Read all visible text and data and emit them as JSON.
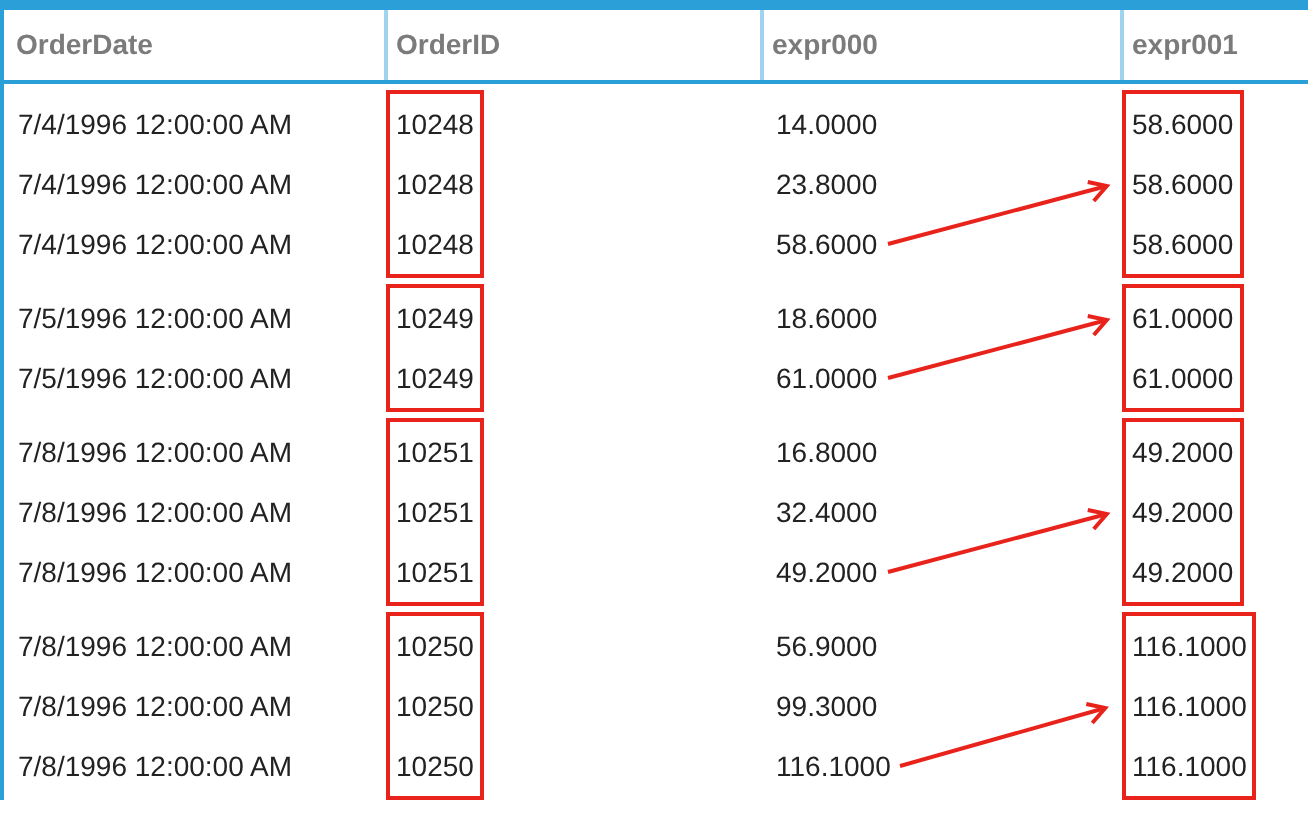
{
  "columns": [
    {
      "label": "OrderDate",
      "boxed": false
    },
    {
      "label": "OrderID",
      "boxed": true
    },
    {
      "label": "expr000",
      "boxed": false
    },
    {
      "label": "expr001",
      "boxed": true
    }
  ],
  "groups": [
    {
      "arrow": true,
      "rows": [
        [
          "7/4/1996 12:00:00 AM",
          "10248",
          "14.0000",
          "58.6000"
        ],
        [
          "7/4/1996 12:00:00 AM",
          "10248",
          "23.8000",
          "58.6000"
        ],
        [
          "7/4/1996 12:00:00 AM",
          "10248",
          "58.6000",
          "58.6000"
        ]
      ]
    },
    {
      "arrow": true,
      "rows": [
        [
          "7/5/1996 12:00:00 AM",
          "10249",
          "18.6000",
          "61.0000"
        ],
        [
          "7/5/1996 12:00:00 AM",
          "10249",
          "61.0000",
          "61.0000"
        ]
      ]
    },
    {
      "arrow": true,
      "rows": [
        [
          "7/8/1996 12:00:00 AM",
          "10251",
          "16.8000",
          "49.2000"
        ],
        [
          "7/8/1996 12:00:00 AM",
          "10251",
          "32.4000",
          "49.2000"
        ],
        [
          "7/8/1996 12:00:00 AM",
          "10251",
          "49.2000",
          "49.2000"
        ]
      ]
    },
    {
      "arrow": true,
      "rows": [
        [
          "7/8/1996 12:00:00 AM",
          "10250",
          "56.9000",
          "116.1000"
        ],
        [
          "7/8/1996 12:00:00 AM",
          "10250",
          "99.3000",
          "116.1000"
        ],
        [
          "7/8/1996 12:00:00 AM",
          "10250",
          "116.1000",
          "116.1000"
        ]
      ]
    }
  ]
}
